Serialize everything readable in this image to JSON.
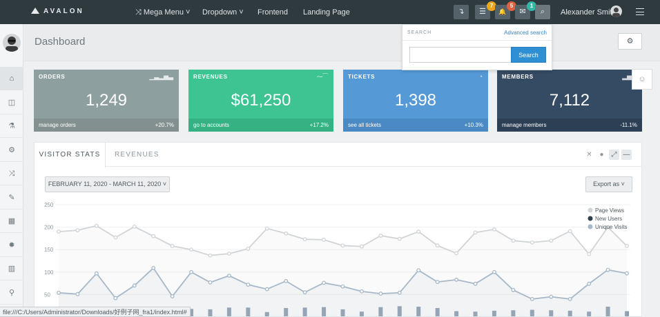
{
  "topbar": {
    "brand": "AVALON",
    "nav": [
      {
        "label": "Mega Menu ˅",
        "icon": "shuffle-icon"
      },
      {
        "label": "Dropdown ˅"
      },
      {
        "label": "Frontend"
      },
      {
        "label": "Landing Page"
      }
    ],
    "buttons": [
      {
        "icon": "fork-icon",
        "glyph": "↴"
      },
      {
        "icon": "list-icon",
        "glyph": "☰",
        "badge": "7",
        "badge_color": "#e8a81e"
      },
      {
        "icon": "bell-icon",
        "glyph": "🔔",
        "badge": "5",
        "badge_color": "#e06040"
      },
      {
        "icon": "mail-icon",
        "glyph": "✉",
        "badge": "1",
        "badge_color": "#33b7a7"
      },
      {
        "icon": "search-icon",
        "glyph": "⌕"
      }
    ],
    "user_name": "Alexander Smith"
  },
  "search_popup": {
    "label": "SEARCH",
    "advanced": "Advanced search",
    "placeholder": "",
    "button": "Search"
  },
  "page": {
    "title": "Dashboard"
  },
  "sidebar": {
    "items": [
      {
        "name": "home",
        "glyph": "⌂"
      },
      {
        "name": "layout",
        "glyph": "◫"
      },
      {
        "name": "flask",
        "glyph": "⚗"
      },
      {
        "name": "cogs",
        "glyph": "⚙"
      },
      {
        "name": "shuffle",
        "glyph": "⤨"
      },
      {
        "name": "pencil",
        "glyph": "✎"
      },
      {
        "name": "table",
        "glyph": "▦"
      },
      {
        "name": "settings",
        "glyph": "✹"
      },
      {
        "name": "chart",
        "glyph": "▥"
      },
      {
        "name": "map-marker",
        "glyph": "⚲"
      }
    ]
  },
  "cards": [
    {
      "title": "ORDERS",
      "value": "1,249",
      "link": "manage orders",
      "change": "+20.7%",
      "color": "#8e9fa0",
      "foot": "#82918f"
    },
    {
      "title": "REVENUES",
      "value": "$61,250",
      "link": "go to accounts",
      "change": "+17.2%",
      "color": "#3ec492",
      "foot": "#36b184"
    },
    {
      "title": "TICKETS",
      "value": "1,398",
      "link": "see all tickets",
      "change": "+10.3%",
      "color": "#5599d6",
      "foot": "#4a89c3"
    },
    {
      "title": "MEMBERS",
      "value": "7,112",
      "link": "manage members",
      "change": "-11.1%",
      "color": "#354a63",
      "foot": "#2d3f55"
    }
  ],
  "panel": {
    "tabs": [
      "VISITOR STATS",
      "REVENUES"
    ],
    "date_range": "FEBRUARY 11, 2020 - MARCH 11, 2020 ˅",
    "export": "Export as ˅"
  },
  "status_url": "file:///C:/Users/Administrator/Downloads/好例子网_fra1/index.html#",
  "chart_data": {
    "type": "line",
    "ylim": [
      0,
      250
    ],
    "yticks": [
      50,
      100,
      150,
      200,
      250
    ],
    "legend_position": "top-right",
    "series": [
      {
        "name": "Page Views",
        "color": "#d0d4d7",
        "values": [
          190,
          193,
          203,
          177,
          201,
          180,
          158,
          150,
          137,
          141,
          152,
          197,
          186,
          173,
          172,
          159,
          157,
          181,
          174,
          190,
          159,
          142,
          188,
          195,
          170,
          166,
          170,
          191,
          140,
          200,
          158
        ]
      },
      {
        "name": "New Users",
        "color": "#a6b8c8",
        "values": [
          54,
          51,
          97,
          42,
          70,
          109,
          46,
          100,
          77,
          92,
          72,
          62,
          80,
          55,
          76,
          68,
          57,
          52,
          54,
          104,
          78,
          83,
          74,
          100,
          60,
          40,
          45,
          40,
          74,
          105,
          97
        ]
      },
      {
        "name": "Unique Visits",
        "color": "#8a9db0",
        "values": [
          0,
          18,
          0,
          0,
          17,
          8,
          0,
          18,
          17,
          21,
          21,
          11,
          20,
          21,
          22,
          17,
          12,
          22,
          24,
          23,
          20,
          13,
          12,
          14,
          15,
          16,
          15,
          14,
          12,
          23,
          13
        ]
      }
    ]
  }
}
